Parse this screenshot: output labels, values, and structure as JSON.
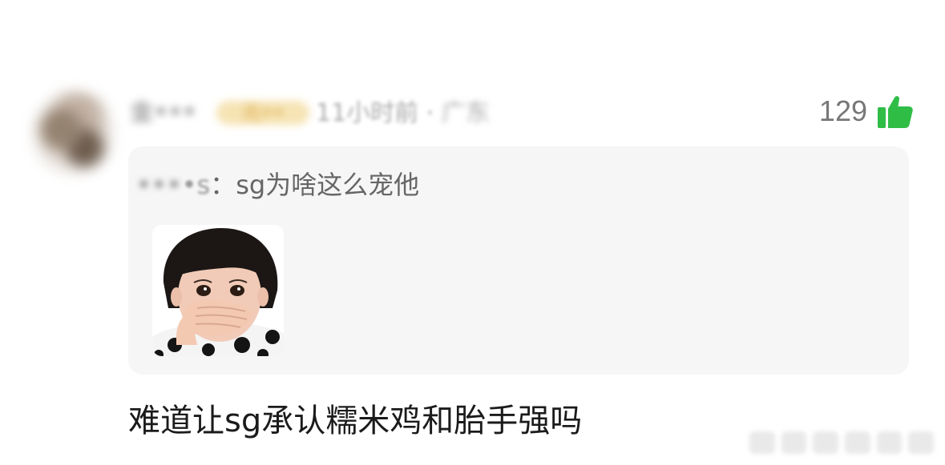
{
  "comment": {
    "username": "金•••",
    "badge": "元••",
    "time": "11小时前",
    "separator": "·",
    "location": "广东",
    "like_count": "129",
    "text": "难道让sg承认糯米鸡和胎手强吗"
  },
  "quote": {
    "author": "•••",
    "author_suffix": "•s",
    "colon": "：",
    "text": "sg为啥这么宠他"
  },
  "icons": {
    "like": "thumbs-up-icon",
    "avatar": "avatar-image",
    "sticker": "covering-mouth-sticker"
  },
  "colors": {
    "like_green": "#2fbd46",
    "quote_bg": "#f6f6f6",
    "badge_bg": "#f6e4b4",
    "text_dark": "#1b1b1b",
    "text_gray": "#777777"
  }
}
